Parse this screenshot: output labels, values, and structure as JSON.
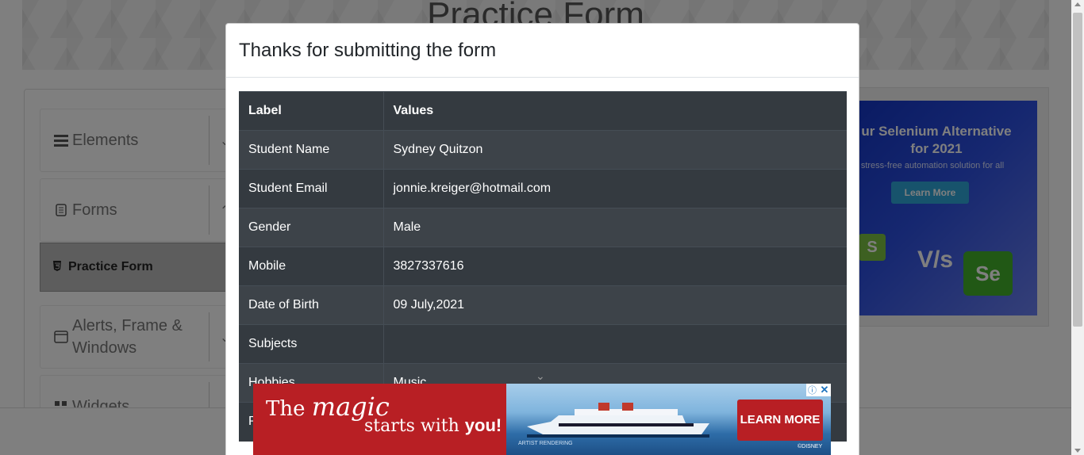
{
  "background": {
    "banner_title": "Practice Form",
    "sidebar": {
      "elements_label": "Elements",
      "forms_label": "Forms",
      "practice_form_label": "Practice Form",
      "alerts_label": "Alerts, Frame & Windows",
      "widgets_label": "Widgets"
    },
    "right_ad": {
      "headline": "ur Selenium Alternative for 2021",
      "subtext": "stress-free automation solution for all",
      "button": "Learn More",
      "vs": "V/s",
      "se_logo": "Se",
      "s_logo": "S"
    }
  },
  "modal": {
    "title": "Thanks for submitting the form",
    "table": {
      "headers": [
        "Label",
        "Values"
      ],
      "rows": [
        {
          "label": "Student Name",
          "value": "Sydney Quitzon"
        },
        {
          "label": "Student Email",
          "value": "jonnie.kreiger@hotmail.com"
        },
        {
          "label": "Gender",
          "value": "Male"
        },
        {
          "label": "Mobile",
          "value": "3827337616"
        },
        {
          "label": "Date of Birth",
          "value": "09 July,2021"
        },
        {
          "label": "Subjects",
          "value": ""
        },
        {
          "label": "Hobbies",
          "value": "Music"
        },
        {
          "label": "P",
          "value": ""
        }
      ]
    }
  },
  "bottom_ad": {
    "line1_prefix": "The ",
    "line1_emph": "magic",
    "line2_prefix": "starts with ",
    "line2_emph": "you!",
    "cta": "LEARN MORE",
    "artist": "ARTIST RENDERING",
    "copyright": "©DISNEY",
    "info_icon": "info-icon",
    "close_icon": "close-icon",
    "colors": {
      "red": "#b81f24",
      "sea": "#2e6da8"
    }
  },
  "colors": {
    "table_bg": "#343a40",
    "overlay": "rgba(0,0,0,0.5)"
  }
}
